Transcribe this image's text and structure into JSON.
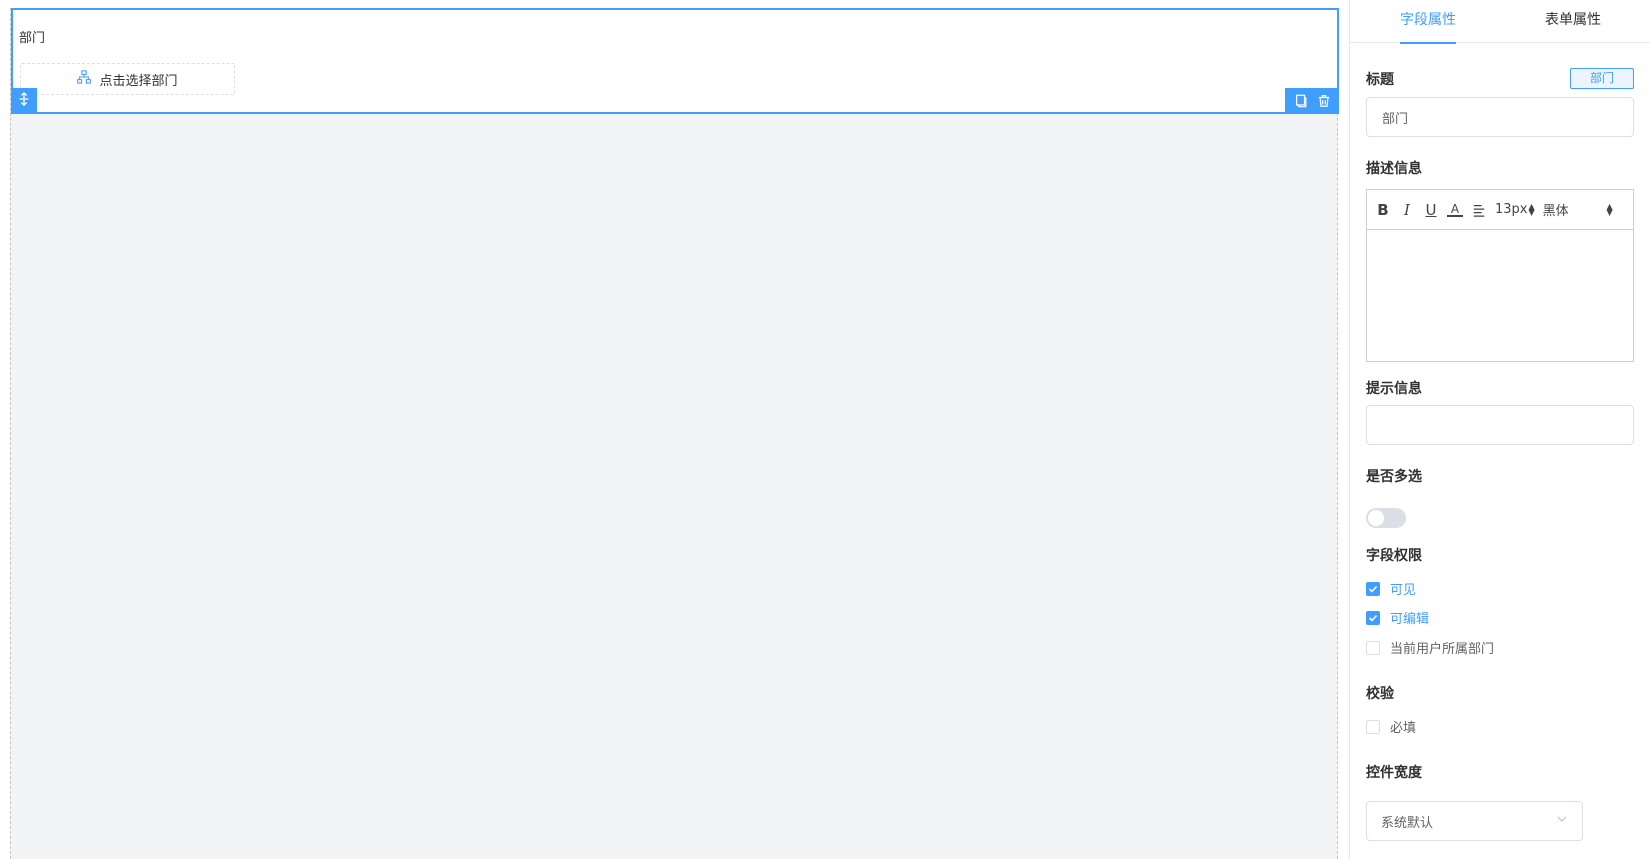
{
  "canvas": {
    "field": {
      "title": "部门",
      "picker_label": "点击选择部门",
      "picker_icon": "org-chart-icon"
    },
    "icons": {
      "drag": "move-vertical-icon",
      "copy": "copy-icon",
      "delete": "trash-icon"
    }
  },
  "panel": {
    "tabs": [
      {
        "label": "字段属性",
        "active": true
      },
      {
        "label": "表单属性",
        "active": false
      }
    ],
    "title": {
      "label": "标题",
      "type_tag": "部门",
      "value": "部门"
    },
    "description": {
      "label": "描述信息",
      "toolbar": {
        "bold": "B",
        "italic": "I",
        "underline": "U",
        "color": "A",
        "font_size": "13px",
        "font_family": "黑体"
      }
    },
    "hint": {
      "label": "提示信息",
      "value": ""
    },
    "multiple": {
      "label": "是否多选",
      "enabled": false
    },
    "permissions": {
      "label": "字段权限",
      "options": [
        {
          "label": "可见",
          "checked": true
        },
        {
          "label": "可编辑",
          "checked": true
        },
        {
          "label": "当前用户所属部门",
          "checked": false
        }
      ]
    },
    "validation": {
      "label": "校验",
      "options": [
        {
          "label": "必填",
          "checked": false
        }
      ]
    },
    "width": {
      "label": "控件宽度",
      "value": "系统默认"
    }
  },
  "colors": {
    "accent": "#409eff",
    "canvas_bg": "#f3f4f6",
    "border": "#dcdfe6"
  }
}
